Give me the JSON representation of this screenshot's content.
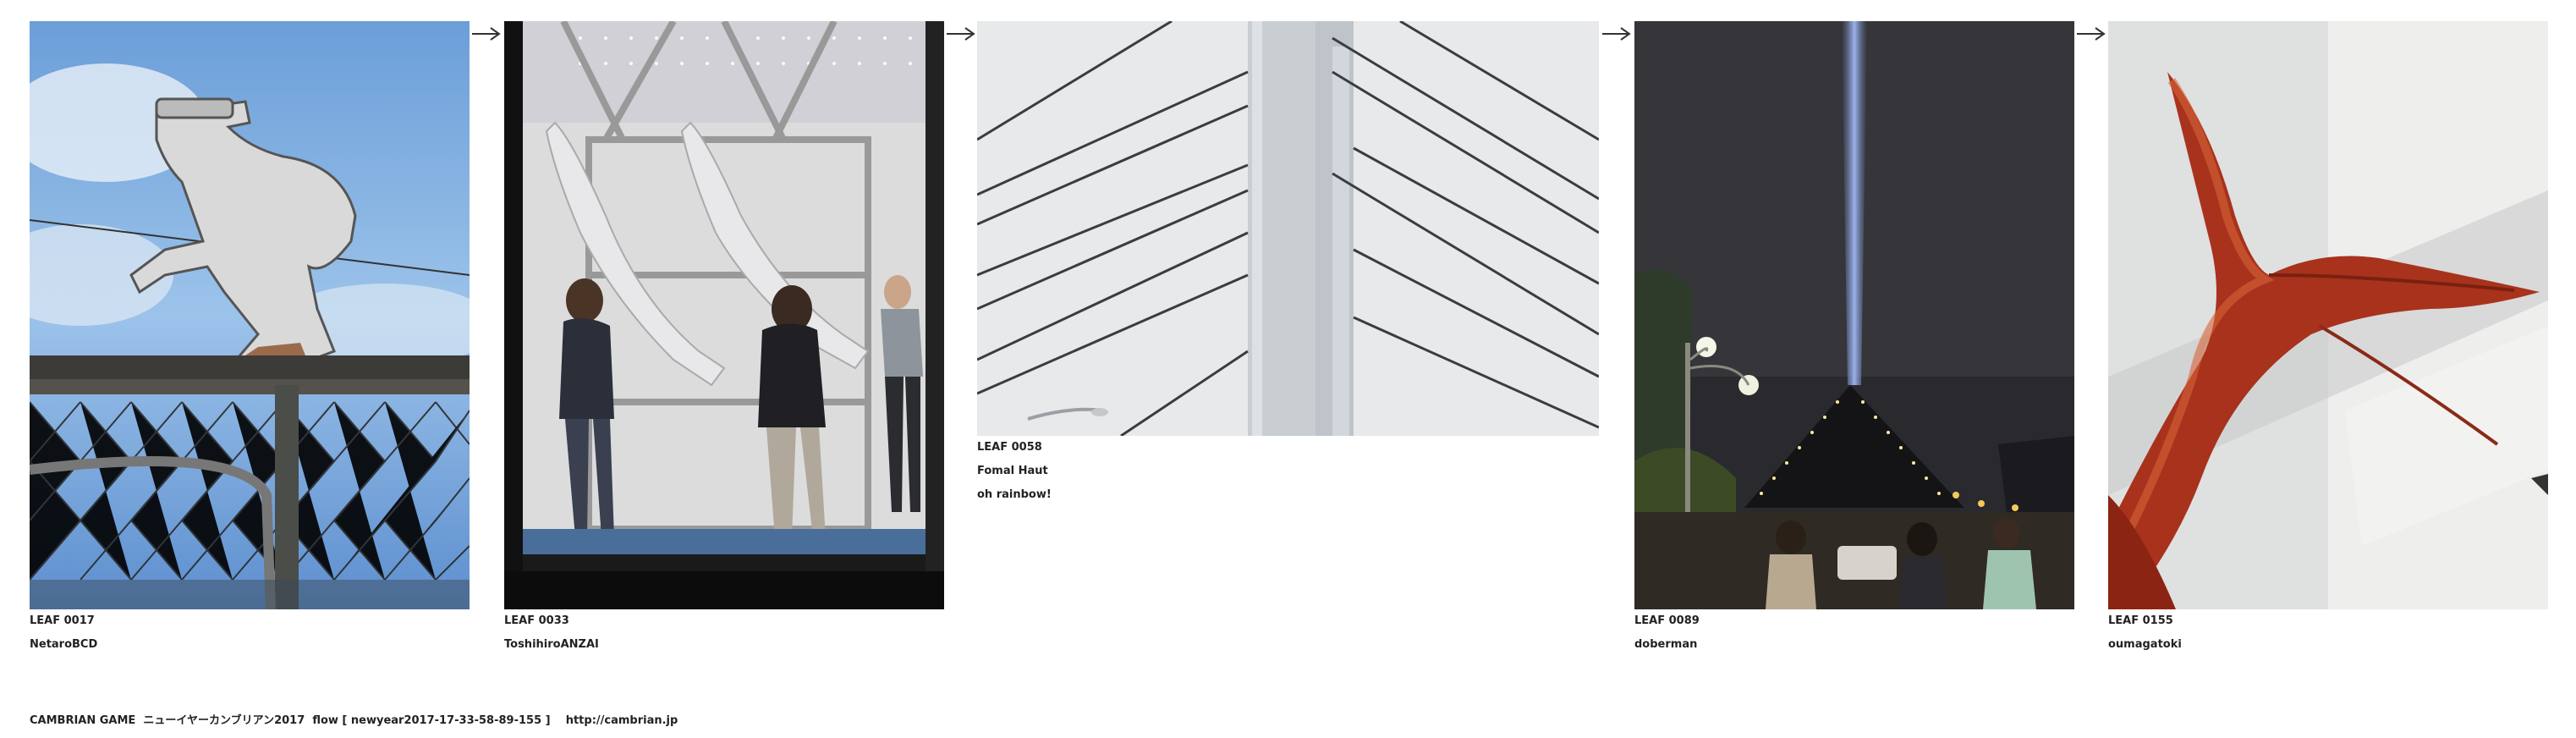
{
  "leaves": [
    {
      "id": "LEAF 0017",
      "author": "NetaroBCD"
    },
    {
      "id": "LEAF 0033",
      "author": "ToshihiroANZAI"
    },
    {
      "id": "LEAF 0058",
      "author": "Fomal Haut",
      "comment": "oh rainbow!"
    },
    {
      "id": "LEAF 0089",
      "author": "doberman"
    },
    {
      "id": "LEAF 0155",
      "author": "oumagatoki"
    }
  ],
  "arrows": [
    "→",
    "→",
    "→",
    "→"
  ],
  "footer": {
    "game": "CAMBRIAN GAME",
    "title": "ニューイヤーカンブリアン2017",
    "flow": "flow [ newyear2017-17-33-58-89-155 ]",
    "url": "http://cambrian.jp"
  },
  "photo_subjects": {
    "leaf_0017": "cutout-figure-on-fence",
    "leaf_0033": "mannequins-in-shop-window",
    "leaf_0058": "cable-stayed-bridge-tower",
    "leaf_0089": "pyramid-with-light-beam-at-night",
    "leaf_0155": "red-fish-tail"
  }
}
